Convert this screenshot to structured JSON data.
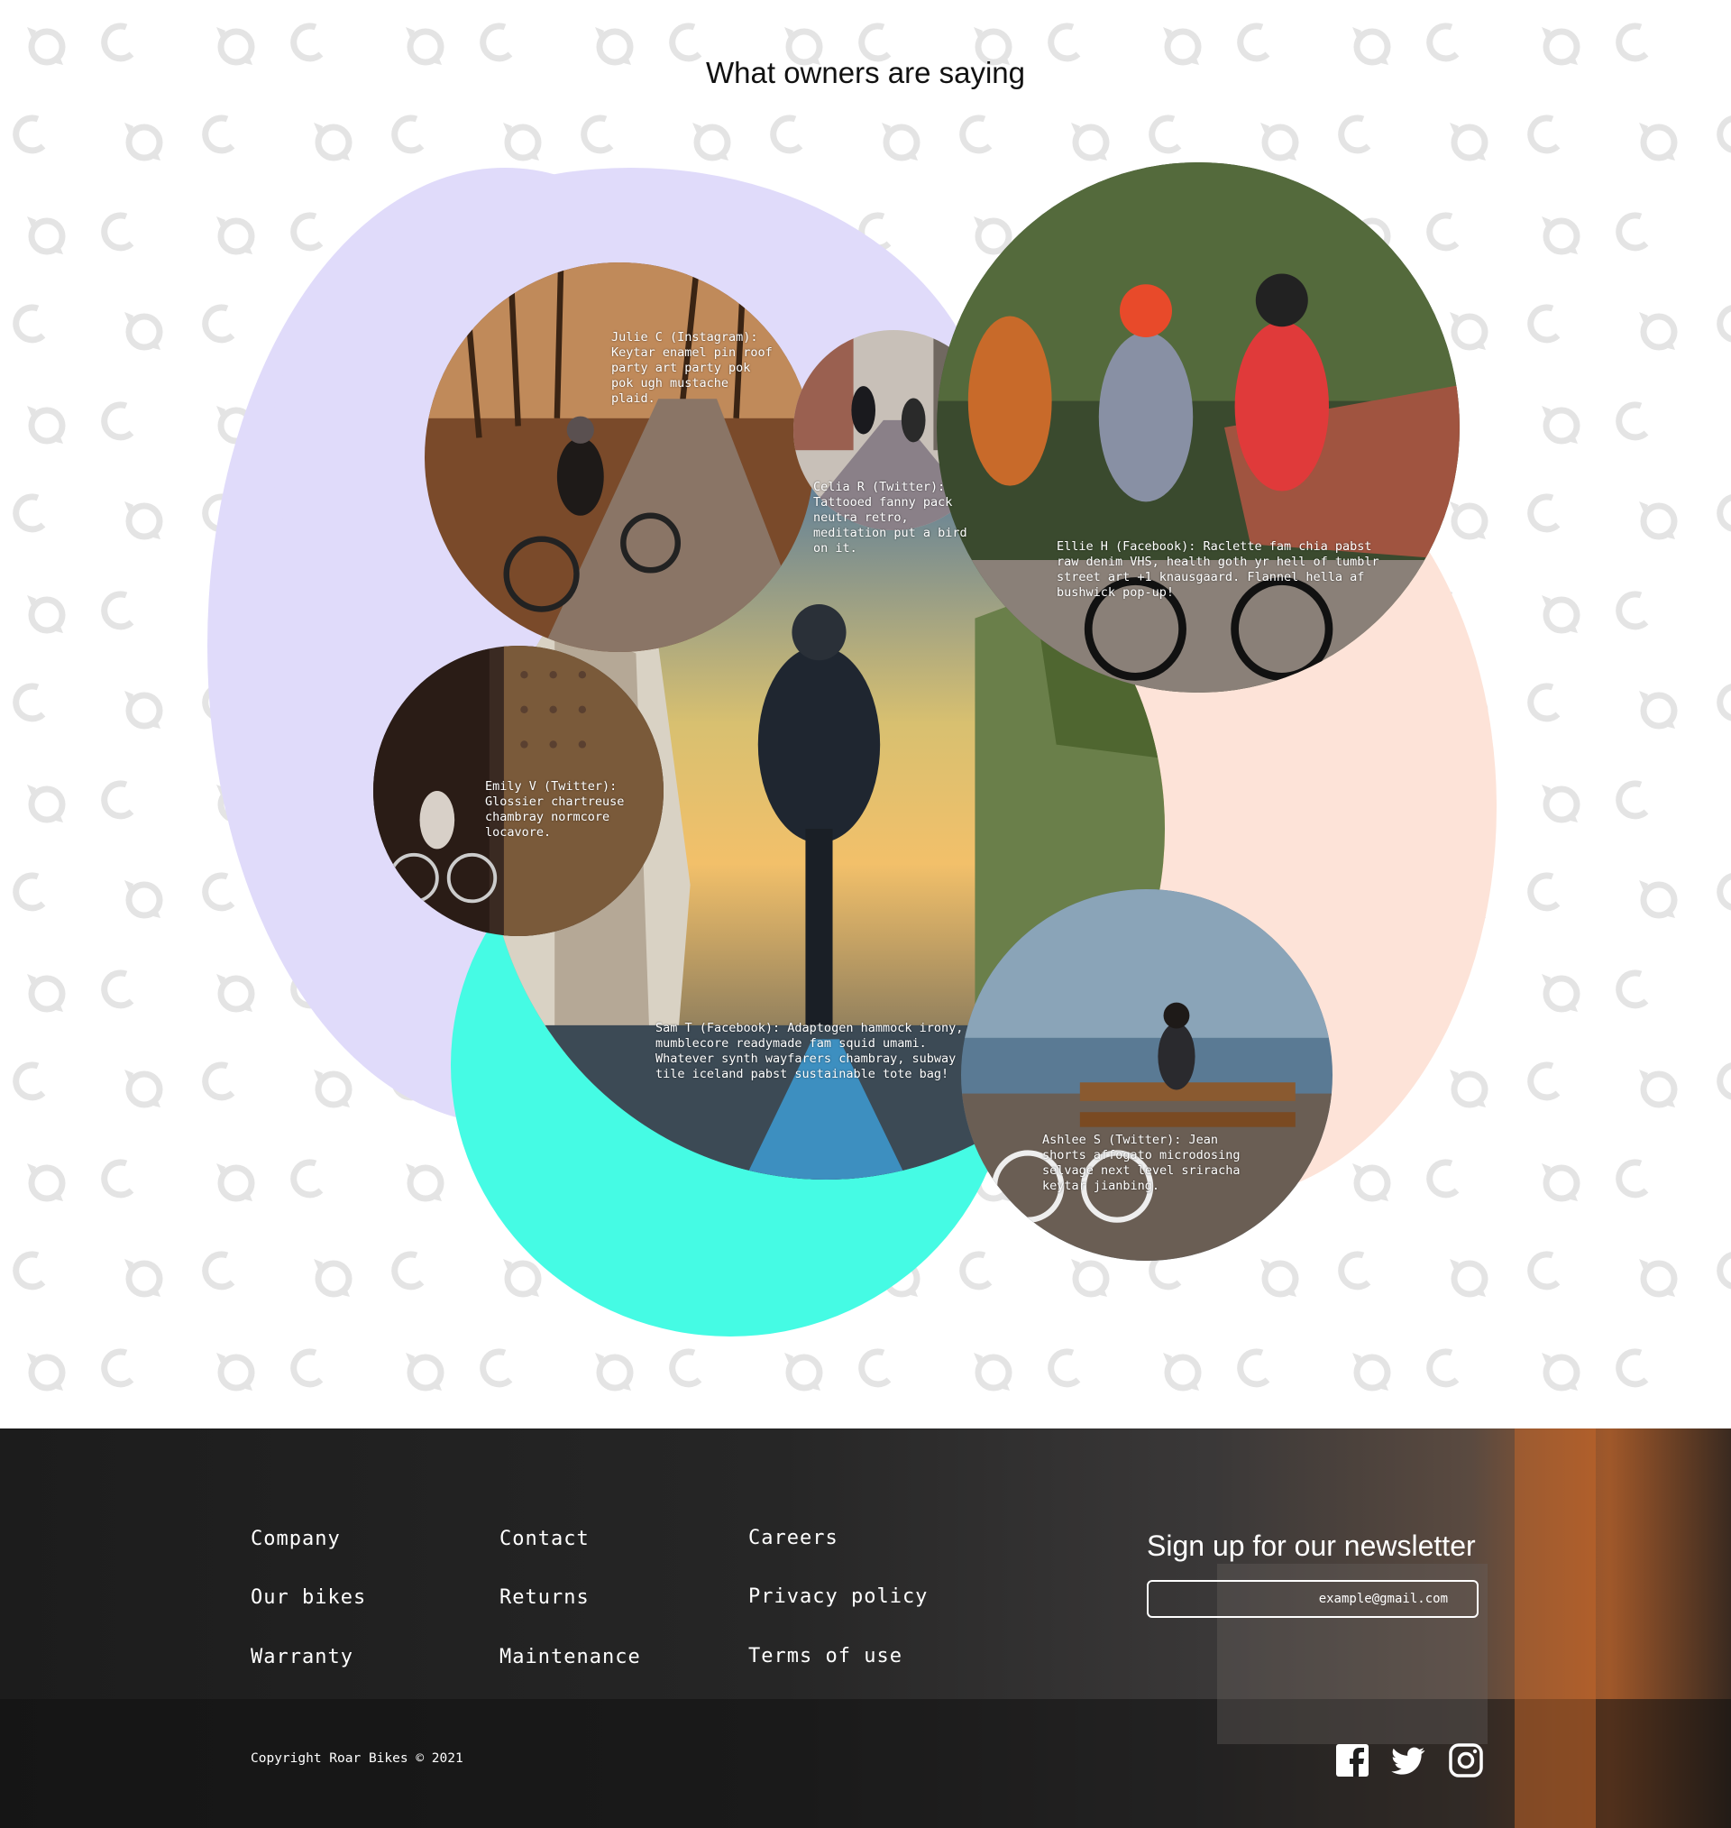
{
  "section": {
    "title": "What owners are saying"
  },
  "colors": {
    "lavender": "#e0dbfa",
    "peach": "#fde3d8",
    "aqua": "#45fbe4",
    "footer_bg": "#1b1b1b",
    "pattern": "#e6e6e6"
  },
  "testimonials": [
    {
      "name": "Julie C",
      "text": "Julie C (Instagram): Keytar enamel pin roof party art party pok pok ugh mustache plaid."
    },
    {
      "name": "Celia R",
      "text": "Celia R (Twitter): Tattooed fanny pack neutra retro, meditation put a bird on it."
    },
    {
      "name": "Ellie H",
      "text": "Ellie H (Facebook): Raclette fam chia pabst raw denim VHS, health goth yr hell of tumblr street art +1 knausgaard. Flannel hella af bushwick pop-up!"
    },
    {
      "name": "Emily V",
      "text": "Emily V (Twitter): Glossier chartreuse chambray normcore locavore."
    },
    {
      "name": "Sam T",
      "text": "Sam T (Facebook): Adaptogen hammock irony, mumblecore readymade fam squid umami. Whatever synth wayfarers chambray, subway tile iceland pabst sustainable tote bag!"
    },
    {
      "name": "Ashlee S",
      "text": "Ashlee S (Twitter): Jean shorts affogato microdosing selvage next level sriracha keytar jianbing."
    }
  ],
  "footer": {
    "links": [
      "Company",
      "Our bikes",
      "Warranty",
      "Contact",
      "Returns",
      "Maintenance",
      "Careers",
      "Privacy policy",
      "Terms of use"
    ],
    "newsletter_title": "Sign up for our newsletter",
    "newsletter_placeholder": "example@gmail.com",
    "copyright": "Copyright Roar Bikes © 2021",
    "social": [
      "facebook-icon",
      "twitter-icon",
      "instagram-icon"
    ]
  }
}
